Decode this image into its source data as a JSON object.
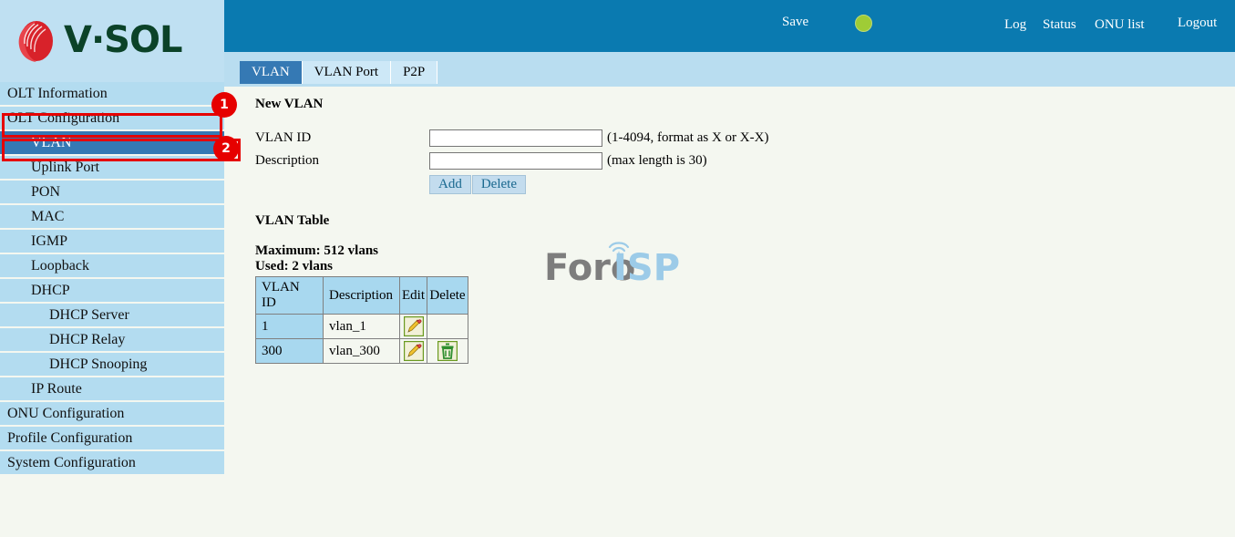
{
  "brand": {
    "logo_text": "V·SOL",
    "logo_mark": "vsol-flame-icon",
    "accent_header": "#0a7ab0",
    "accent_active": "#3579b4",
    "sidebar_bg": "#b3dcf0",
    "content_bg": "#f4f7f0",
    "annotation_red": "#e60000",
    "status_dot_color": "#9fcc36"
  },
  "header": {
    "save_label": "Save",
    "status_dot": "status-indicator-green",
    "links": [
      {
        "label": "Log"
      },
      {
        "label": "Status"
      },
      {
        "label": "ONU list"
      },
      {
        "label": "Logout"
      }
    ]
  },
  "tabs": [
    {
      "label": "VLAN",
      "active": true
    },
    {
      "label": "VLAN Port",
      "active": false
    },
    {
      "label": "P2P",
      "active": false
    }
  ],
  "sidebar": {
    "items": [
      {
        "label": "OLT Information",
        "level": 0,
        "active": false
      },
      {
        "label": "OLT Configuration",
        "level": 0,
        "active": false
      },
      {
        "label": "VLAN",
        "level": 1,
        "active": true
      },
      {
        "label": "Uplink Port",
        "level": 1,
        "active": false
      },
      {
        "label": "PON",
        "level": 1,
        "active": false
      },
      {
        "label": "MAC",
        "level": 1,
        "active": false
      },
      {
        "label": "IGMP",
        "level": 1,
        "active": false
      },
      {
        "label": "Loopback",
        "level": 1,
        "active": false
      },
      {
        "label": "DHCP",
        "level": 1,
        "active": false
      },
      {
        "label": "DHCP Server",
        "level": 2,
        "active": false
      },
      {
        "label": "DHCP Relay",
        "level": 2,
        "active": false
      },
      {
        "label": "DHCP Snooping",
        "level": 2,
        "active": false
      },
      {
        "label": "IP Route",
        "level": 1,
        "active": false
      },
      {
        "label": "ONU Configuration",
        "level": 0,
        "active": false
      },
      {
        "label": "Profile Configuration",
        "level": 0,
        "active": false
      },
      {
        "label": "System Configuration",
        "level": 0,
        "active": false
      }
    ]
  },
  "main": {
    "new_vlan": {
      "title": "New VLAN",
      "vlan_id_label": "VLAN ID",
      "vlan_id_value": "",
      "vlan_id_hint": "(1-4094, format as X or X-X)",
      "description_label": "Description",
      "description_value": "",
      "description_hint": "(max length is 30)",
      "add_label": "Add",
      "delete_label": "Delete"
    },
    "vlan_table": {
      "title": "VLAN Table",
      "maximum_text": "Maximum: 512 vlans",
      "used_text": "Used: 2 vlans",
      "columns": [
        "VLAN ID",
        "Description",
        "Edit",
        "Delete"
      ],
      "rows": [
        {
          "vlan_id": "1",
          "description": "vlan_1",
          "edit_icon": "pencil-edit-icon",
          "delete_icon": ""
        },
        {
          "vlan_id": "300",
          "description": "vlan_300",
          "edit_icon": "pencil-edit-icon",
          "delete_icon": "trash-delete-icon"
        }
      ]
    }
  },
  "watermark": {
    "text_primary": "Foro",
    "text_secondary": "ISP",
    "color_primary": "#7d7d7d",
    "color_secondary": "#9ccbe8"
  },
  "annotations": [
    {
      "badge": "1",
      "target": "OLT Configuration"
    },
    {
      "badge": "2",
      "target": "VLAN"
    }
  ]
}
